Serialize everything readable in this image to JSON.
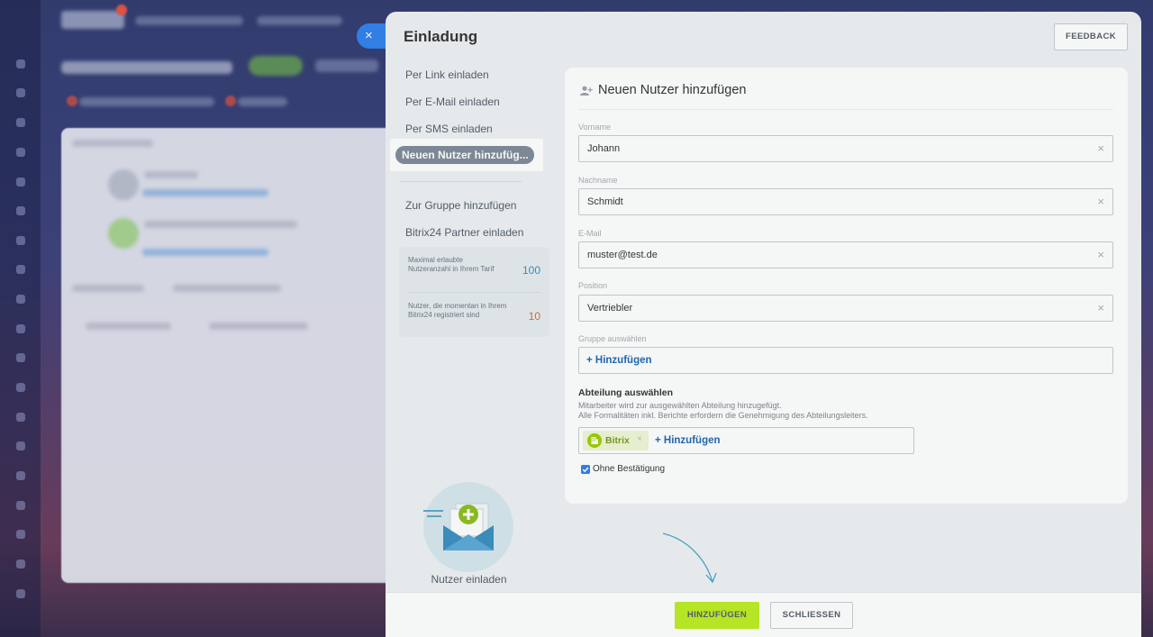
{
  "slider": {
    "title": "Einladung",
    "feedback_label": "FEEDBACK",
    "close_glyph": "×"
  },
  "menu": {
    "items": [
      "Per Link einladen",
      "Per E-Mail einladen",
      "Per SMS einladen"
    ],
    "active": "Neuen Nutzer hinzufüg...",
    "extra": [
      "Zur Gruppe hinzufügen",
      "Bitrix24 Partner einladen"
    ]
  },
  "stats": {
    "max_label": "Maximal erlaubte Nutzeranzahl in Ihrem Tarif",
    "max_value": "100",
    "current_label": "Nutzer, die momentan in Ihrem Bitrix24 registriert sind",
    "current_value": "10",
    "colors": {
      "max": "#2f8fd6",
      "current": "#e5613f"
    }
  },
  "illustration": {
    "caption": "Nutzer einladen",
    "icon": "envelope-plus-icon"
  },
  "form": {
    "title": "Neuen Nutzer hinzufügen",
    "title_icon": "user-plus-icon",
    "fields": {
      "vorname": {
        "label": "Vorname",
        "value": "Johann"
      },
      "nachname": {
        "label": "Nachname",
        "value": "Schmidt"
      },
      "email": {
        "label": "E-Mail",
        "value": "muster@test.de"
      },
      "position": {
        "label": "Position",
        "value": "Vertriebler"
      }
    },
    "group": {
      "label": "Gruppe auswählen",
      "add": "+ Hinzufügen"
    },
    "department": {
      "title": "Abteilung auswählen",
      "hint_1": "Mitarbeiter wird zur ausgewählten Abteilung hinzugefügt.",
      "hint_2": "Alle Formalitäten inkl. Berichte erfordern die Genehmigung des Abteilungsleiters.",
      "tag": "Bitrix",
      "add": "+ Hinzufügen"
    },
    "checkbox": {
      "label": "Ohne Bestätigung",
      "checked": true
    },
    "clear_glyph": "×"
  },
  "footer": {
    "primary": "HINZUFÜGEN",
    "secondary": "SCHLIESSEN",
    "primary_color": "#bbed21"
  }
}
